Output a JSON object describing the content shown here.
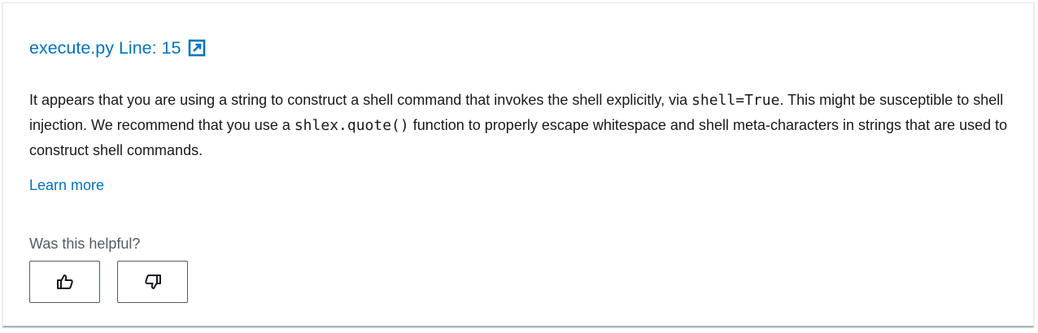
{
  "finding": {
    "title": "execute.py Line: 15",
    "title_icon": "external-link-icon",
    "description": {
      "part1": "It appears that you are using a string to construct a shell command that invokes the shell explicitly, via ",
      "code1": "shell=True",
      "part2": ". This might be susceptible to shell injection. We recommend that you use a ",
      "code2": "shlex.quote()",
      "part3": " function to properly escape whitespace and shell meta-characters in strings that are used to construct shell commands."
    },
    "learn_more": "Learn more"
  },
  "feedback": {
    "question": "Was this helpful?",
    "thumbs_up_icon": "thumbs-up-icon",
    "thumbs_down_icon": "thumbs-down-icon"
  },
  "colors": {
    "link": "#0073bb",
    "text": "#16191f",
    "secondary_text": "#545b64",
    "button_border": "#545b64"
  }
}
